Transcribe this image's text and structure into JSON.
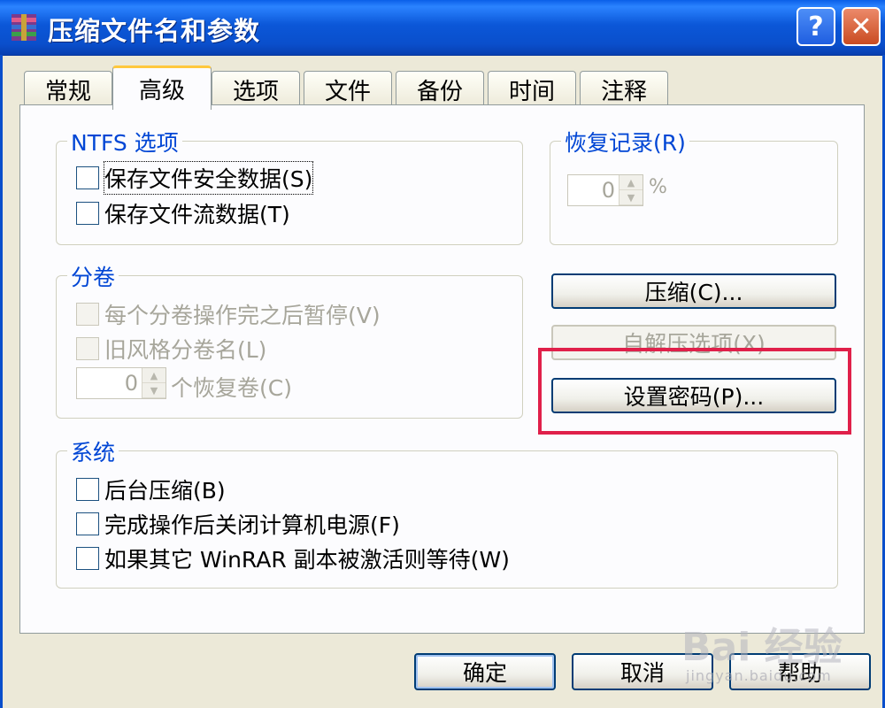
{
  "window": {
    "title": "压缩文件名和参数",
    "help_glyph": "?",
    "close_glyph": "✕"
  },
  "tabs": [
    {
      "label": "常规",
      "active": false
    },
    {
      "label": "高级",
      "active": true
    },
    {
      "label": "选项",
      "active": false
    },
    {
      "label": "文件",
      "active": false
    },
    {
      "label": "备份",
      "active": false
    },
    {
      "label": "时间",
      "active": false
    },
    {
      "label": "注释",
      "active": false
    }
  ],
  "ntfs": {
    "legend": "NTFS 选项",
    "save_security": "保存文件安全数据(S)",
    "save_streams": "保存文件流数据(T)"
  },
  "recovery": {
    "legend": "恢复记录(R)",
    "value": "0",
    "unit": "%"
  },
  "volumes": {
    "legend": "分卷",
    "pause_after_volume": "每个分卷操作完之后暂停(V)",
    "old_style_names": "旧风格分卷名(L)",
    "recovery_volumes_value": "0",
    "recovery_volumes_label": "个恢复卷(C)"
  },
  "buttons": {
    "compression": "压缩(C)...",
    "sfx_options": "自解压选项(X)",
    "set_password": "设置密码(P)...",
    "ok": "确定",
    "cancel": "取消",
    "help": "帮助"
  },
  "system": {
    "legend": "系统",
    "background": "后台压缩(B)",
    "shutdown": "完成操作后关闭计算机电源(F)",
    "wait_other": "如果其它 WinRAR 副本被激活则等待(W)"
  },
  "watermark": {
    "brand": "Bai 经验",
    "url": "jingyan.baidu.com"
  },
  "colors": {
    "highlight": "#e0204a",
    "titlebar": "#0a4fcc",
    "legend_text": "#0046d5"
  }
}
